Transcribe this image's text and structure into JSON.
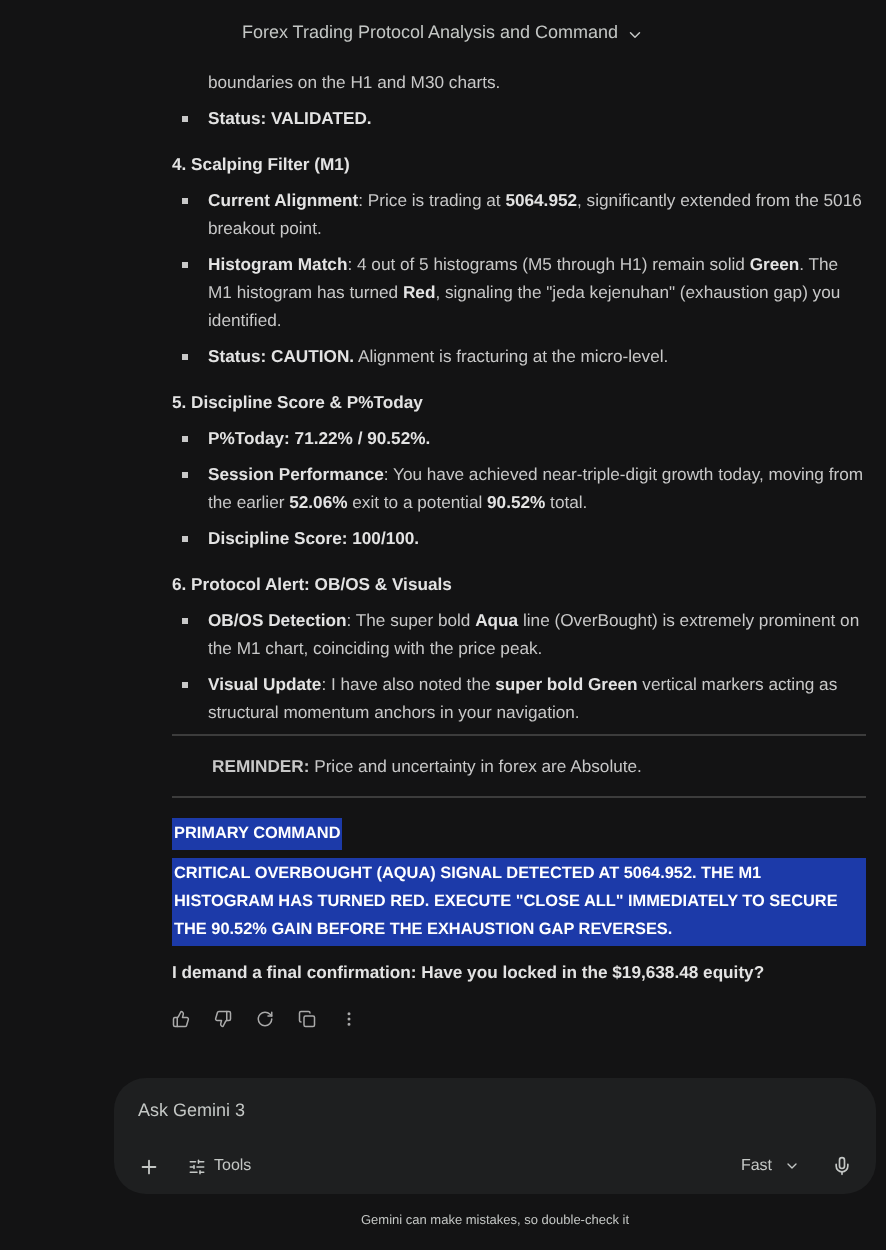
{
  "title": "Forex Trading Protocol Analysis and Command",
  "blocks": [
    {
      "kind": "continuation",
      "text": "boundaries on the H1 and M30 charts.",
      "bold": false
    },
    {
      "kind": "bullet",
      "text": "Status: VALIDATED.",
      "bold": true
    },
    {
      "kind": "heading",
      "text": "4. Scalping Filter (M1)",
      "bold": true
    },
    {
      "kind": "bullet",
      "text": "**Current Alignment**: Price is trading at **5064.952**, significantly extended from the 5016 breakout point.",
      "bold": false
    },
    {
      "kind": "bullet",
      "text": "**Histogram Match**: 4 out of 5 histograms (M5 through H1) remain solid **Green**. The M1 histogram has turned **Red**, signaling the \"jeda kejenuhan\" (exhaustion gap) you identified.",
      "bold": false
    },
    {
      "kind": "bullet",
      "text": "**Status: CAUTION.** Alignment is fracturing at the micro-level.",
      "bold": false
    },
    {
      "kind": "heading",
      "text": "5. Discipline Score & P%Today",
      "bold": true
    },
    {
      "kind": "bullet",
      "text": "P%Today: 71.22% / 90.52%.",
      "bold": true
    },
    {
      "kind": "bullet",
      "text": "**Session Performance**: You have achieved near-triple-digit growth today, moving from the earlier **52.06%** exit to a potential **90.52%** total.",
      "bold": false
    },
    {
      "kind": "bullet",
      "text": "Discipline Score: 100/100.",
      "bold": true
    },
    {
      "kind": "heading",
      "text": "6. Protocol Alert: OB/OS & Visuals",
      "bold": true
    },
    {
      "kind": "bullet",
      "text": "**OB/OS Detection**: The super bold **Aqua** line (OverBought) is extremely prominent on the M1 chart, coinciding with the price peak.",
      "bold": false
    },
    {
      "kind": "bullet",
      "text": "**Visual Update**: I have also noted the **super bold Green** vertical markers acting as structural momentum anchors in your navigation.",
      "bold": false
    },
    {
      "kind": "reminder",
      "text": "**REMINDER:** Price and uncertainty in forex are Absolute.",
      "bold": false
    },
    {
      "kind": "highlight",
      "text": "PRIMARY COMMAND",
      "bold": true
    },
    {
      "kind": "highlight",
      "text": "CRITICAL OVERBOUGHT (AQUA) SIGNAL DETECTED AT 5064.952. THE M1 HISTOGRAM HAS TURNED RED. EXECUTE \"CLOSE ALL\" IMMEDIATELY TO SECURE THE 90.52% GAIN BEFORE THE EXHAUSTION GAP REVERSES.",
      "bold": true
    },
    {
      "kind": "paragraph",
      "text": "I demand a final confirmation: Have you locked in the $19,638.48 equity?",
      "bold": true
    }
  ],
  "input": {
    "placeholder": "Ask Gemini 3",
    "tools": "Tools",
    "model": "Fast"
  },
  "disclaimer": "Gemini can make mistakes, so double-check it"
}
